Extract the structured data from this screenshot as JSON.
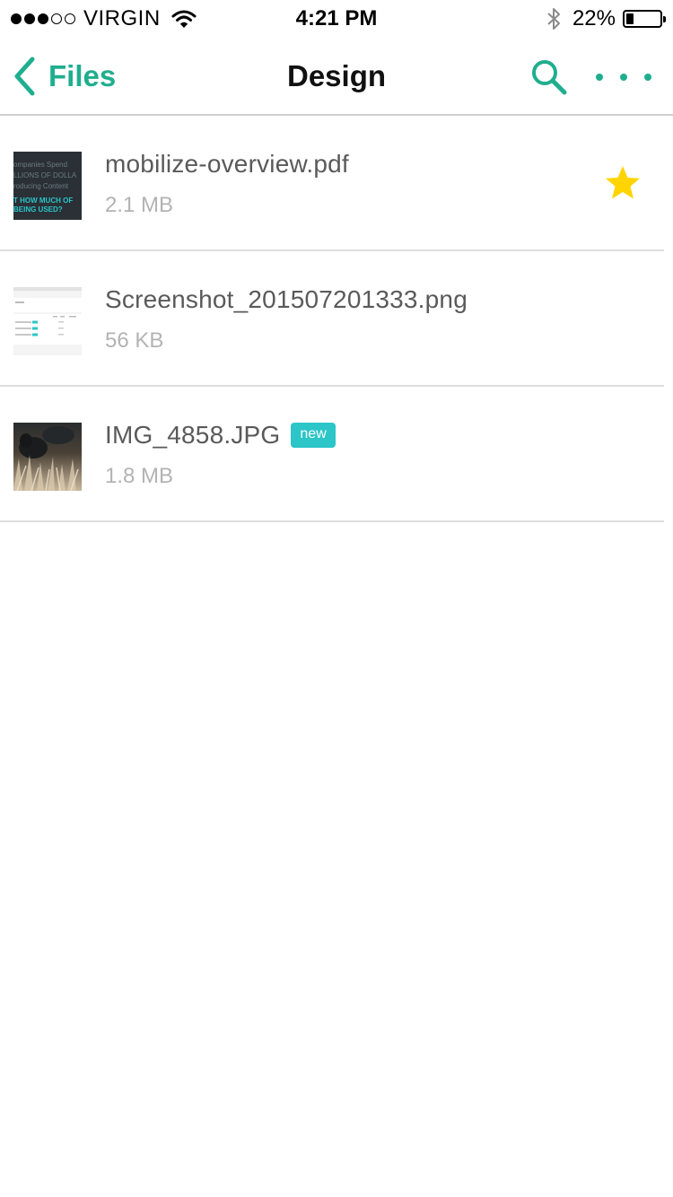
{
  "status_bar": {
    "carrier": "VIRGIN",
    "signal_bars_filled": 3,
    "signal_bars_total": 5,
    "time": "4:21 PM",
    "battery_percent_label": "22%",
    "battery_level": 0.22
  },
  "nav": {
    "back_label": "Files",
    "title": "Design",
    "search_icon": "search-icon",
    "more_icon": "more-dots-icon",
    "accent_color": "#1fae8e"
  },
  "files": [
    {
      "name": "mobilize-overview.pdf",
      "size": "2.1 MB",
      "starred": true,
      "badge": "",
      "thumb_lines": [
        "ompanies Spend",
        "LLIONS OF DOLLA",
        "roducing Content",
        "T HOW MUCH OF",
        "BEING USED?"
      ]
    },
    {
      "name": "Screenshot_201507201333.png",
      "size": "56 KB",
      "starred": false,
      "badge": ""
    },
    {
      "name": "IMG_4858.JPG",
      "size": "1.8 MB",
      "starred": false,
      "badge": "new"
    }
  ],
  "colors": {
    "star": "#ffd400",
    "badge": "#2cc5c8"
  }
}
